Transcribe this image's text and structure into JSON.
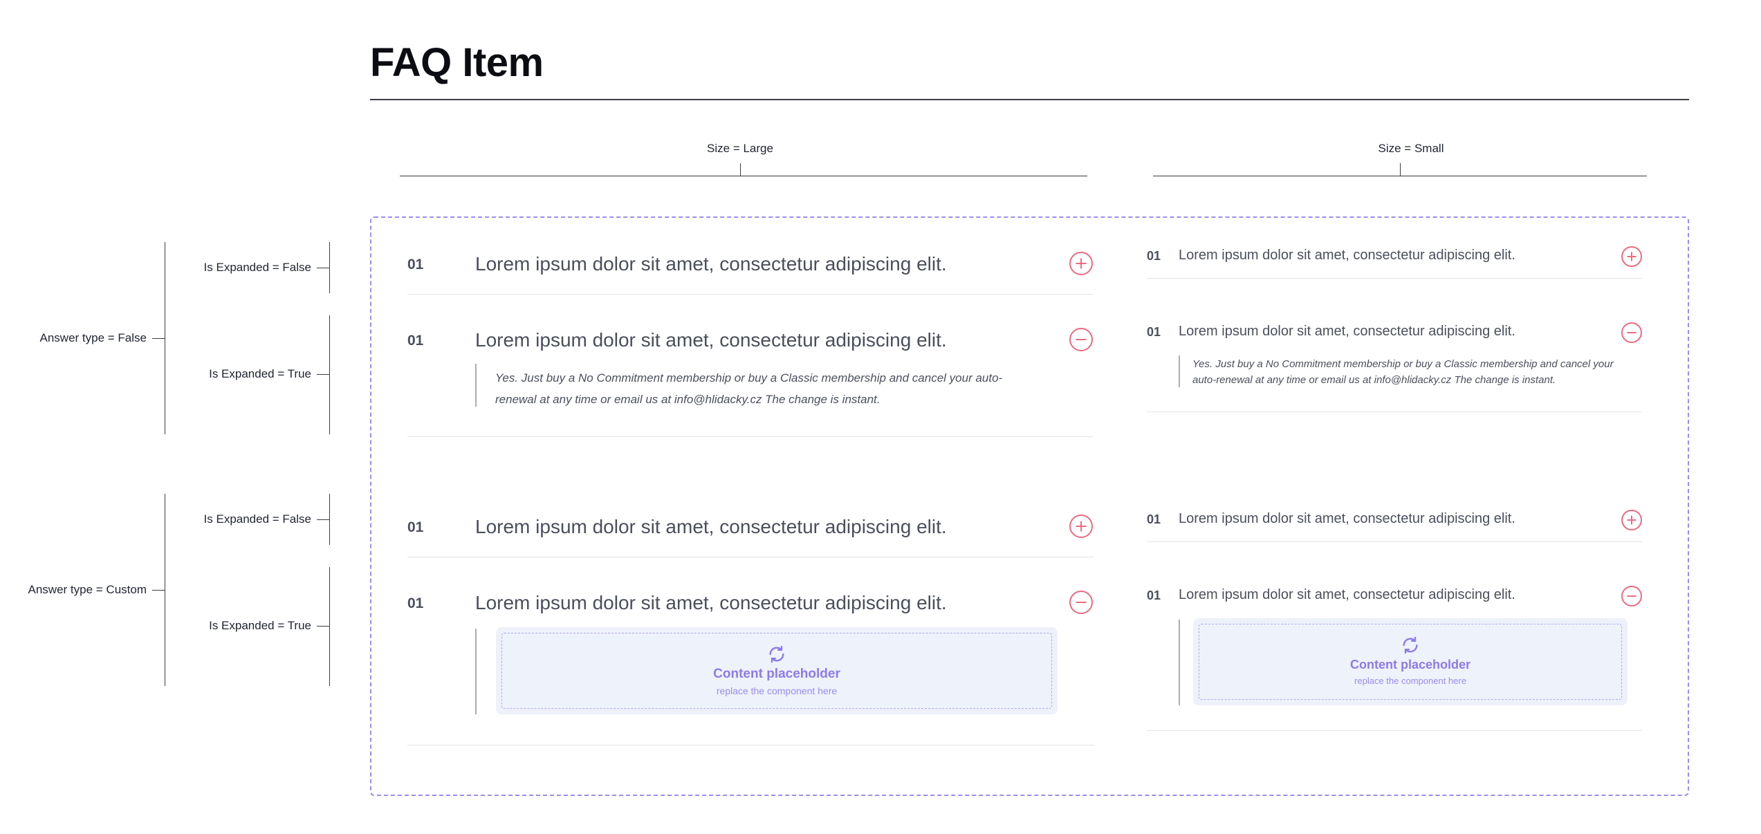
{
  "title": "FAQ Item",
  "columns": {
    "large": "Size = Large",
    "small": "Size = Small"
  },
  "annotations": {
    "answer_false": "Answer type = False",
    "answer_custom": "Answer type = Custom",
    "expanded_false": "Is Expanded = False",
    "expanded_true": "Is Expanded = True"
  },
  "item": {
    "number": "01",
    "question": "Lorem ipsum dolor sit amet, consectetur adipiscing elit.",
    "answer_line1_large": "Yes. Just buy a No Commitment membership or buy a Classic membership and cancel your auto-",
    "answer_line2_large": "renewal at any time or email us at info@hlidacky.cz The change is instant.",
    "answer_line1_small": "Yes. Just buy a No Commitment membership or buy a Classic membership and cancel your",
    "answer_line2_small": "auto-renewal at any time or email us at info@hlidacky.cz The change is instant."
  },
  "placeholder": {
    "title": "Content placeholder",
    "subtitle": "replace the component here"
  },
  "icons": {
    "expand": "plus-icon",
    "collapse": "minus-icon",
    "placeholder": "refresh-icon"
  },
  "colors": {
    "accent": "#ee6a80",
    "frame": "#9d8cf2",
    "placeholder": "#8c7be8"
  }
}
